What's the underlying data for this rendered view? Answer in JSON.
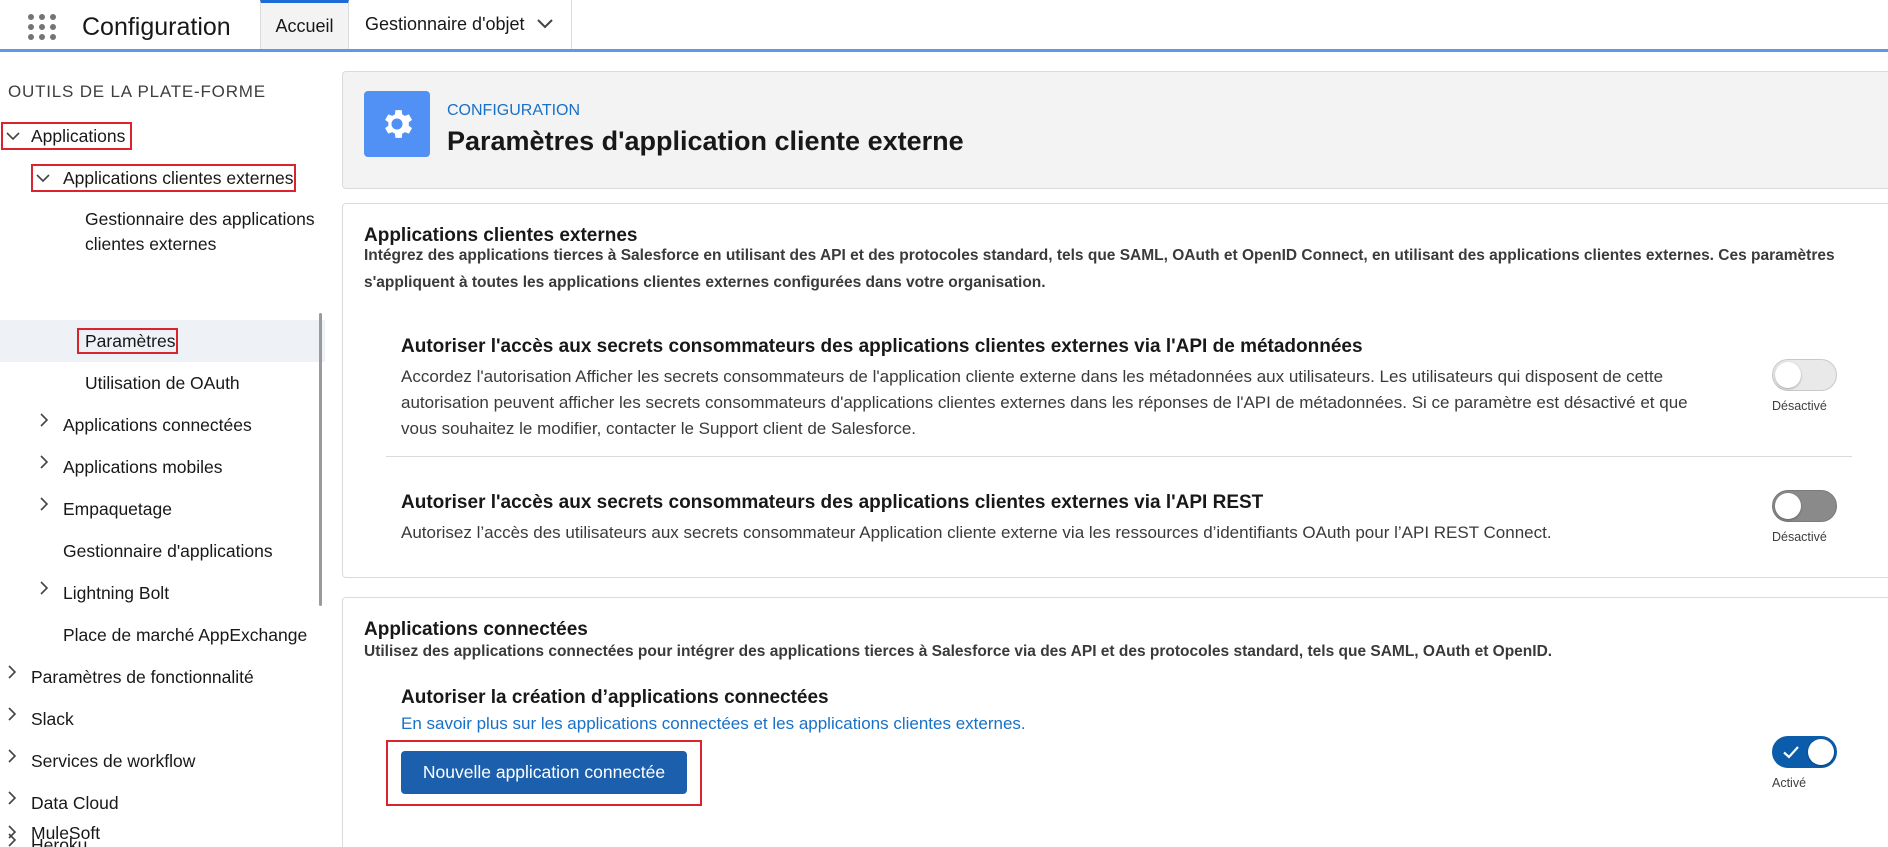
{
  "topbar": {
    "app_title": "Configuration",
    "tabs": [
      {
        "label": "Accueil"
      },
      {
        "label": "Gestionnaire d'objet"
      }
    ]
  },
  "sidebar": {
    "heading": "OUTILS DE LA PLATE-FORME",
    "items": [
      {
        "label": "Applications"
      },
      {
        "label": "Applications clientes externes"
      },
      {
        "label_line1": "Gestionnaire des applications",
        "label_line2": "clientes externes"
      },
      {
        "label": "Paramètres"
      },
      {
        "label": "Utilisation de OAuth"
      },
      {
        "label": "Applications connectées"
      },
      {
        "label": "Applications mobiles"
      },
      {
        "label": "Empaquetage"
      },
      {
        "label": "Gestionnaire d'applications"
      },
      {
        "label": "Lightning Bolt"
      },
      {
        "label": "Place de marché AppExchange"
      },
      {
        "label": "Paramètres de fonctionnalité"
      },
      {
        "label": "Slack"
      },
      {
        "label": "Services de workflow"
      },
      {
        "label": "Data Cloud"
      },
      {
        "label": "Heroku"
      },
      {
        "label": "MuleSoft"
      }
    ]
  },
  "header": {
    "breadcrumb": "CONFIGURATION",
    "title": "Paramètres d'application cliente externe",
    "icon": "gear-icon"
  },
  "external_apps": {
    "title": "Applications clientes externes",
    "desc_line1": "Intégrez des applications tierces à Salesforce en utilisant des API et des protocoles standard, tels que SAML, OAuth et OpenID Connect, en utilisant des applications clientes externes. Ces paramètres",
    "desc_line2": "s'appliquent à toutes les applications clientes externes configurées dans votre organisation.",
    "settings": [
      {
        "title": "Autoriser l'accès aux secrets consommateurs des applications clientes externes via l'API de métadonnées",
        "desc_line1": "Accordez l'autorisation Afficher les secrets consommateurs de l'application cliente externe dans les métadonnées aux utilisateurs. Les utilisateurs qui disposent de cette",
        "desc_line2": "autorisation peuvent afficher les secrets consommateurs d'applications clientes externes dans les réponses de l'API de métadonnées. Si ce paramètre est désactivé et que",
        "desc_line3": "vous souhaitez le modifier, contacter le Support client de Salesforce.",
        "toggle_state": "off",
        "toggle_label": "Désactivé"
      },
      {
        "title": "Autoriser l'accès aux secrets consommateurs des applications clientes externes via l'API REST",
        "desc_line1": "Autorisez l’accès des utilisateurs aux secrets consommateur Application cliente externe via les ressources d’identifiants OAuth pour l’API REST Connect.",
        "toggle_state": "off",
        "toggle_label": "Désactivé"
      }
    ]
  },
  "connected_apps": {
    "title": "Applications connectées",
    "desc": "Utilisez des applications connectées pour intégrer des applications tierces à Salesforce via des API et des protocoles standard, tels que SAML, OAuth et OpenID.",
    "setting": {
      "title": "Autoriser la création d’applications connectées",
      "link": "En savoir plus sur les applications connectées et les applications clientes externes.",
      "toggle_state": "on",
      "toggle_label": "Activé"
    },
    "new_button": "Nouvelle application connectée"
  },
  "colors": {
    "accent": "#1b6ad6",
    "highlight_box": "#d9232e",
    "toggle_on": "#0b5cab",
    "gear_tile": "#5190f5",
    "link": "#1871c7"
  }
}
